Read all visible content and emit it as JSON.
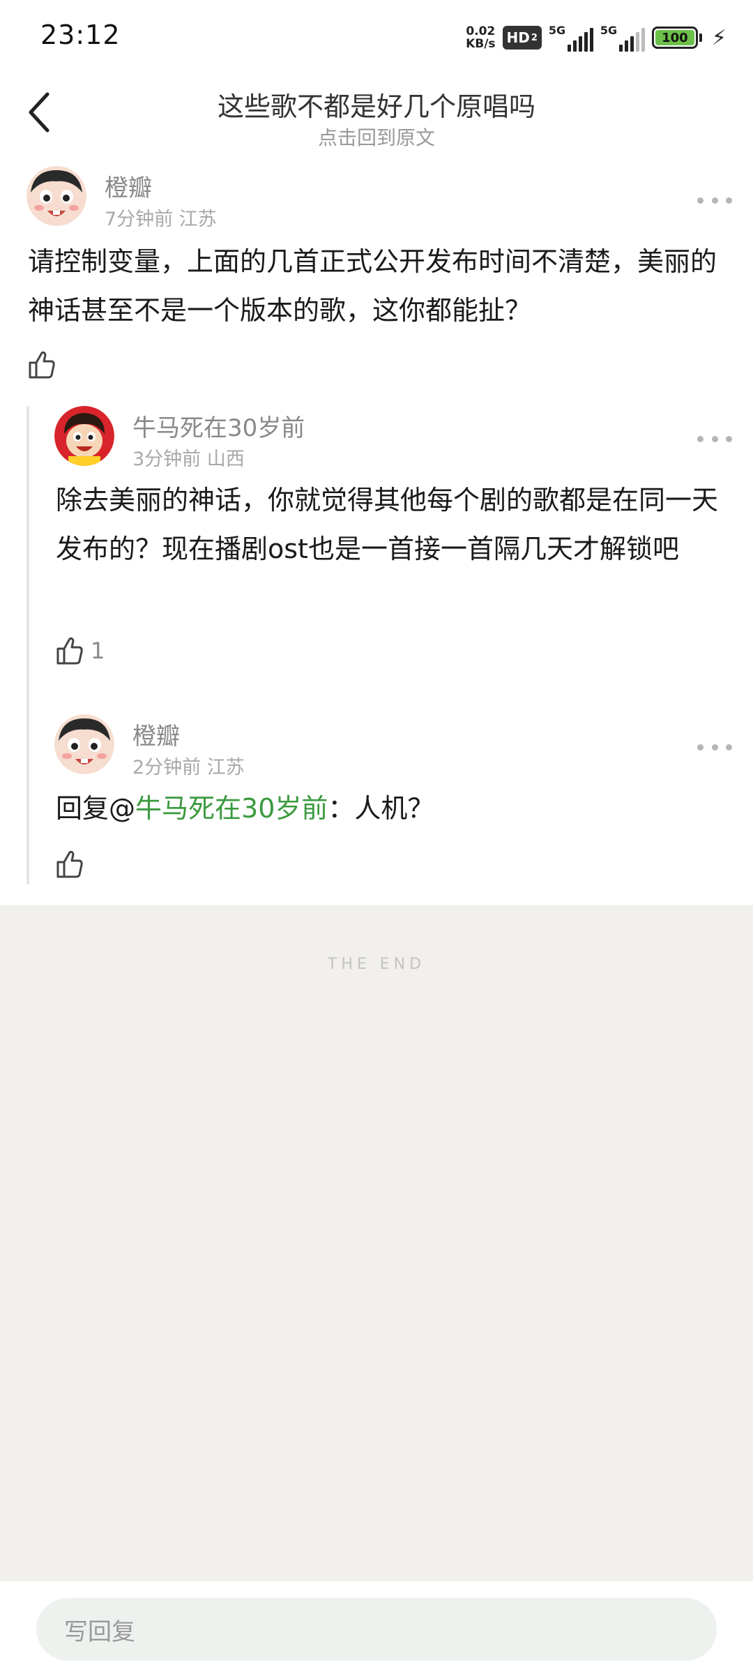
{
  "status_bar": {
    "time": "23:12",
    "net_speed_value": "0.02",
    "net_speed_unit": "KB/s",
    "hd_label": "HD",
    "hd_sub": "2",
    "signal1_label": "5G",
    "signal2_label": "5G",
    "battery_level": "100",
    "battery_color": "#6cc04a",
    "charging_icon": "bolt-icon"
  },
  "header": {
    "back_icon": "chevron-left-icon",
    "title": "这些歌不都是好几个原唱吗",
    "subtitle": "点击回到原文"
  },
  "comments": [
    {
      "user": "橙瓣",
      "time": "7分钟前",
      "location": "江苏",
      "content": "请控制变量，上面的几首正式公开发布时间不清楚，美丽的神话甚至不是一个版本的歌，这你都能扯？",
      "likes": ""
    },
    {
      "user": "牛马死在30岁前",
      "time": "3分钟前",
      "location": "山西",
      "content": "除去美丽的神话，你就觉得其他每个剧的歌都是在同一天发布的？现在播剧ost也是一首接一首隔几天才解锁吧",
      "likes": "1"
    },
    {
      "user": "橙瓣",
      "time": "2分钟前",
      "location": "江苏",
      "reply_prefix": "回复@",
      "reply_to": "牛马死在30岁前",
      "reply_suffix": "：人机？",
      "likes": ""
    }
  ],
  "footer": {
    "end_text": "THE END",
    "reply_placeholder": "写回复"
  },
  "colors": {
    "accent_green": "#3a9a3e",
    "end_background": "#f1f0ec"
  }
}
